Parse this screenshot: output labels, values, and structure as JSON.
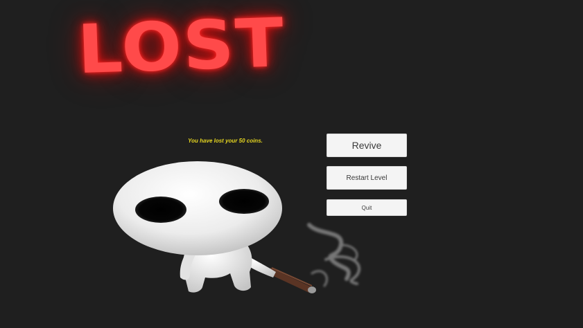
{
  "title": "LOST",
  "message": "You have lost your 50 coins.",
  "buttons": {
    "revive": "Revive",
    "restart": "Restart Level",
    "quit": "Quit"
  },
  "colors": {
    "background": "#1f1f1f",
    "title": "#ff4a4a",
    "message": "#e6d620",
    "button_bg": "#f4f4f4"
  },
  "illustration": {
    "subject": "white-big-eyed-creature-holding-smoking-stick"
  }
}
